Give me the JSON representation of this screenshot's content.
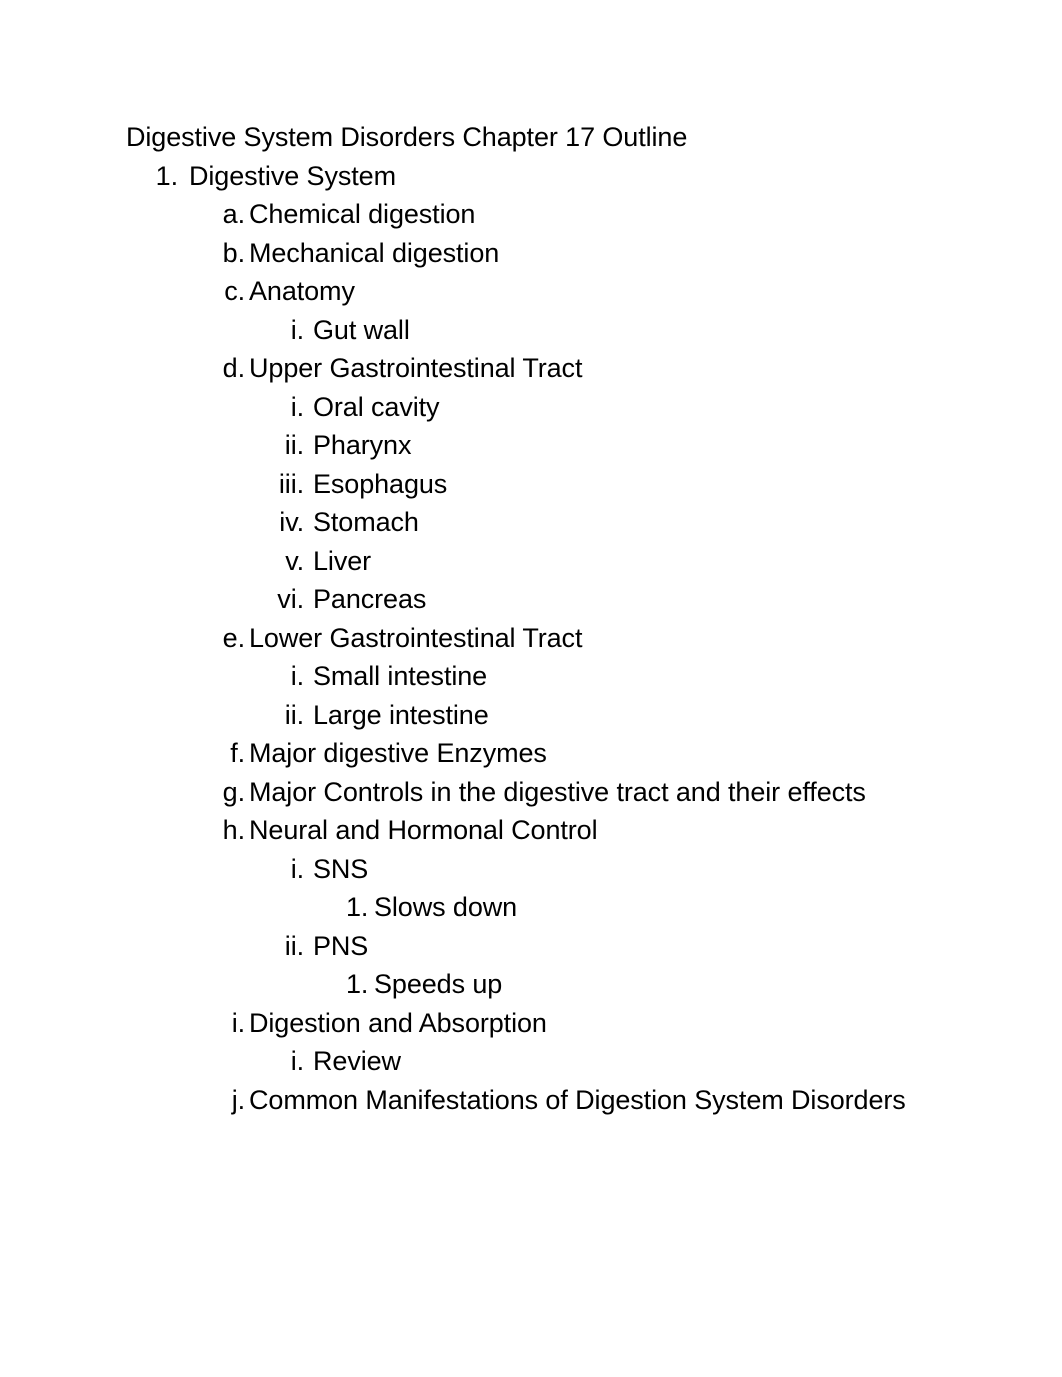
{
  "document": {
    "title": "Digestive System Disorders Chapter 17 Outline",
    "outline": [
      {
        "marker": "1.",
        "text": "Digestive System",
        "level": "num"
      },
      {
        "marker": "a.",
        "text": "Chemical digestion",
        "level": "alpha"
      },
      {
        "marker": "b.",
        "text": "Mechanical digestion",
        "level": "alpha"
      },
      {
        "marker": "c.",
        "text": "Anatomy",
        "level": "alpha"
      },
      {
        "marker": "i.",
        "text": "Gut wall",
        "level": "roman"
      },
      {
        "marker": "d.",
        "text": "Upper Gastrointestinal Tract",
        "level": "alpha"
      },
      {
        "marker": "i.",
        "text": "Oral cavity",
        "level": "roman"
      },
      {
        "marker": "ii.",
        "text": "Pharynx",
        "level": "roman"
      },
      {
        "marker": "iii.",
        "text": "Esophagus",
        "level": "roman"
      },
      {
        "marker": "iv.",
        "text": "Stomach",
        "level": "roman"
      },
      {
        "marker": "v.",
        "text": "Liver",
        "level": "roman"
      },
      {
        "marker": "vi.",
        "text": "Pancreas",
        "level": "roman"
      },
      {
        "marker": "e.",
        "text": "Lower Gastrointestinal Tract",
        "level": "alpha"
      },
      {
        "marker": "i.",
        "text": "Small intestine",
        "level": "roman"
      },
      {
        "marker": "ii.",
        "text": "Large intestine",
        "level": "roman"
      },
      {
        "marker": "f.",
        "text": "Major digestive Enzymes",
        "level": "alpha"
      },
      {
        "marker": "g.",
        "text": "Major Controls in the digestive tract and their effects",
        "level": "alpha"
      },
      {
        "marker": "h.",
        "text": "Neural and Hormonal Control",
        "level": "alpha"
      },
      {
        "marker": "i.",
        "text": "SNS",
        "level": "roman"
      },
      {
        "marker": "1.",
        "text": "Slows down",
        "level": "sub"
      },
      {
        "marker": "ii.",
        "text": "PNS",
        "level": "roman"
      },
      {
        "marker": "1.",
        "text": "Speeds up",
        "level": "sub"
      },
      {
        "marker": "i.",
        "text": "Digestion and Absorption",
        "level": "alpha"
      },
      {
        "marker": "i.",
        "text": "Review",
        "level": "roman"
      },
      {
        "marker": "j.",
        "text": "Common Manifestations of Digestion System Disorders",
        "level": "alpha"
      }
    ]
  },
  "colors": {
    "page_background": "#ffffff",
    "text": "#000000"
  }
}
